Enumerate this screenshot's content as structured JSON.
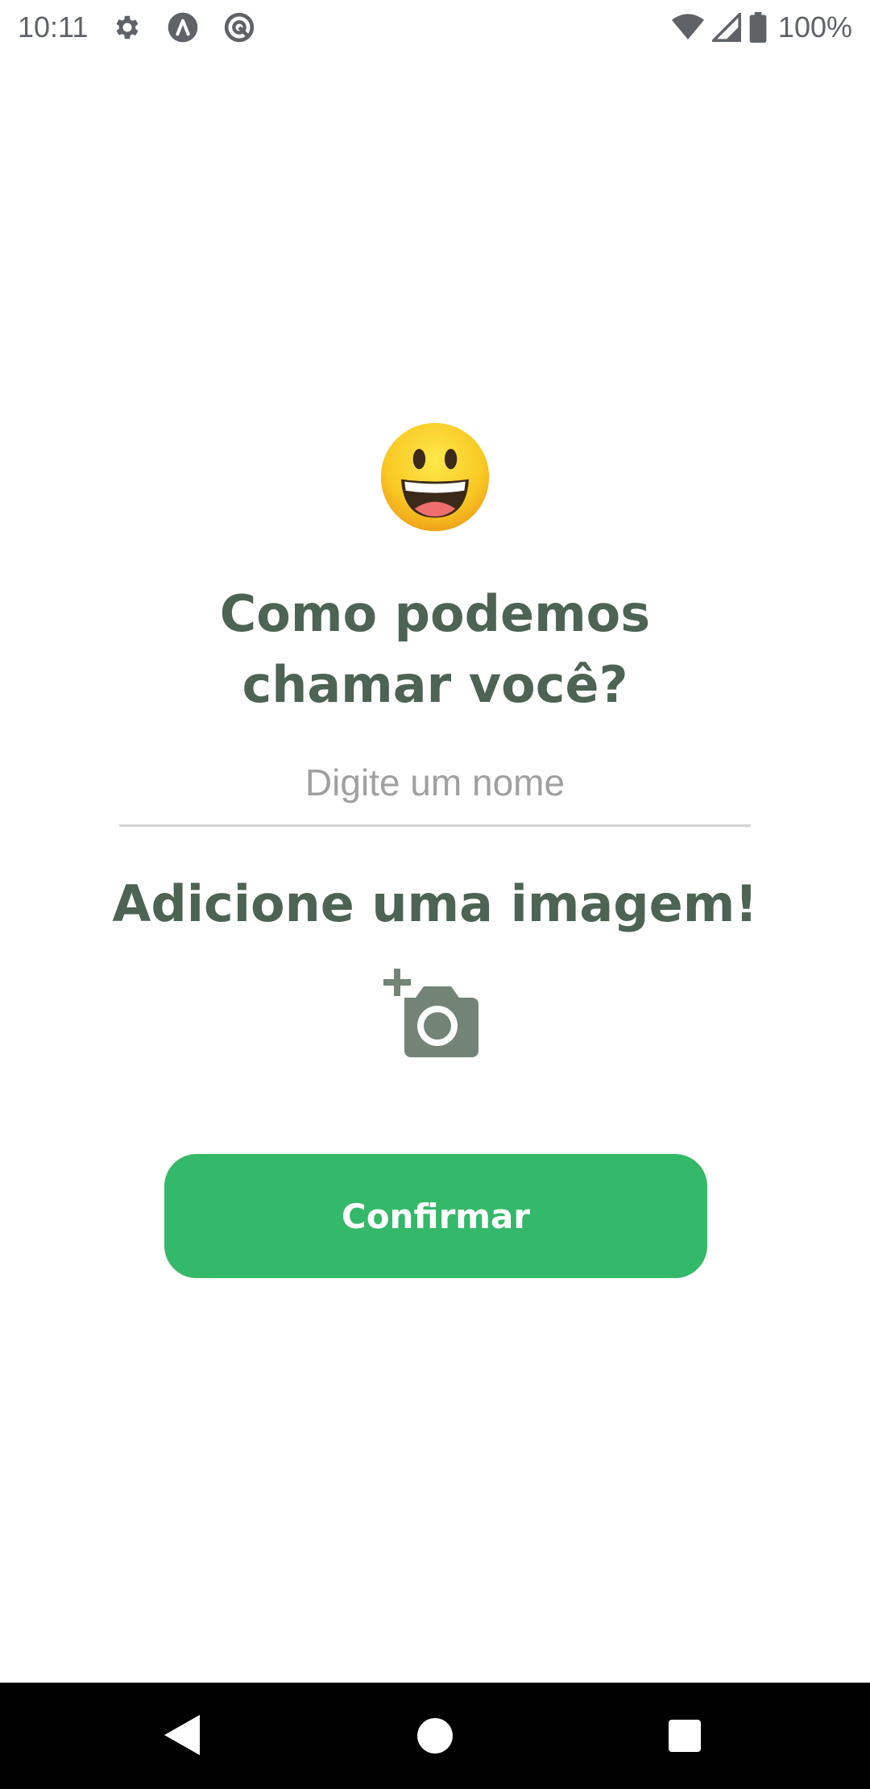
{
  "status_bar": {
    "time": "10:11",
    "battery_percent": "100%",
    "icons_left": [
      "settings-icon",
      "accessibility-icon",
      "app-icon"
    ],
    "icons_right": [
      "wifi-icon",
      "signal-icon",
      "battery-icon"
    ]
  },
  "onboarding": {
    "emoji_icon": "grinning-face-icon",
    "title_line1": "Como podemos",
    "title_line2": "chamar você?",
    "name_input": {
      "placeholder": "Digite um nome",
      "value": ""
    },
    "image_title": "Adicione uma imagem!",
    "camera_icon": "add-a-photo-icon",
    "confirm_label": "Confirmar"
  },
  "nav_bar": {
    "icons": [
      "back-icon",
      "home-icon",
      "recent-apps-icon"
    ]
  },
  "colors": {
    "heading": "#4d6353",
    "primary_button": "#34b869",
    "camera_icon": "#738477",
    "divider": "#d3d3d3"
  }
}
